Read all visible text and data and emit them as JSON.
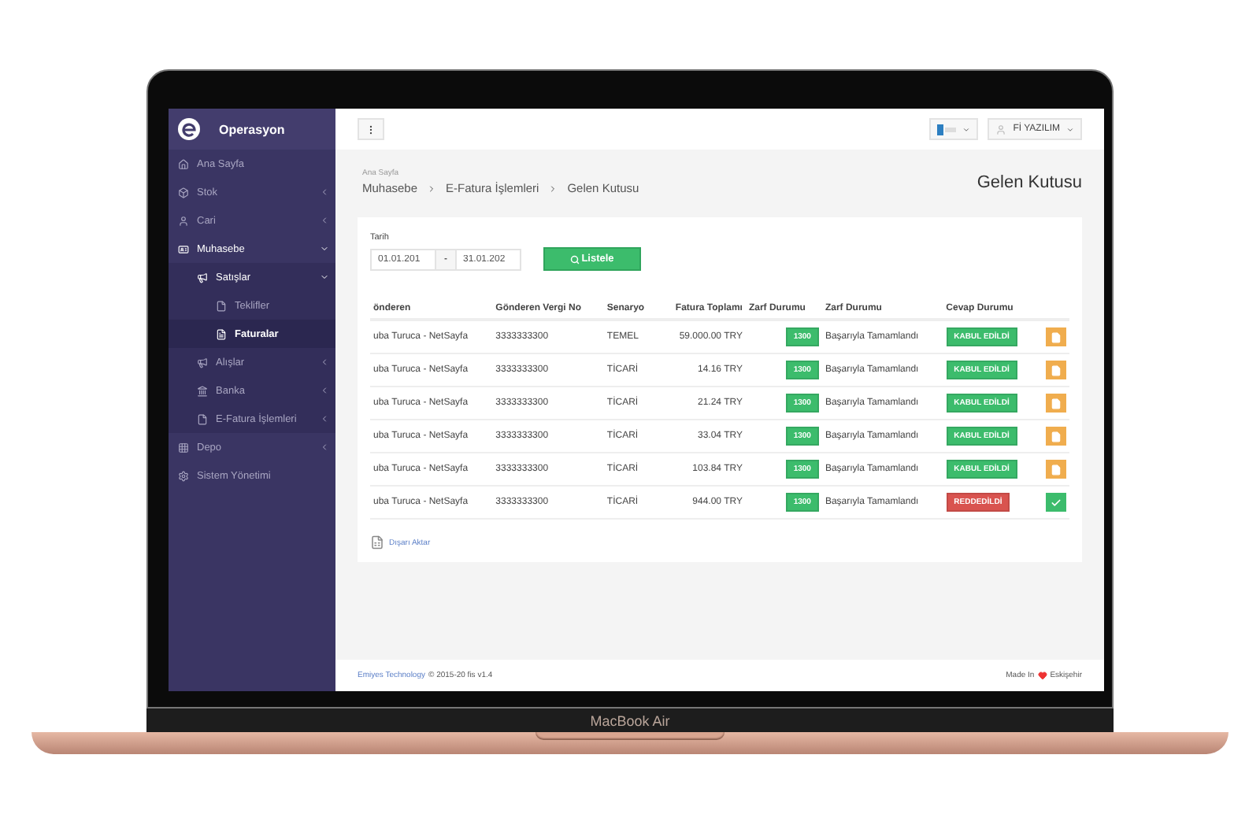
{
  "device": {
    "label": "MacBook Air"
  },
  "sidebar": {
    "title": "Operasyon",
    "items": [
      {
        "label": "Ana Sayfa",
        "expanded": false,
        "selected": false,
        "has_children": false
      },
      {
        "label": "Stok",
        "expanded": false,
        "selected": false,
        "has_children": true
      },
      {
        "label": "Cari",
        "expanded": false,
        "selected": false,
        "has_children": true
      },
      {
        "label": "Muhasebe",
        "expanded": true,
        "selected": false,
        "has_children": true,
        "children": [
          {
            "label": "Satışlar",
            "expanded": true,
            "selected": false,
            "has_children": true,
            "children": [
              {
                "label": "Teklifler",
                "expanded": false,
                "selected": false,
                "has_children": false
              },
              {
                "label": "Faturalar",
                "expanded": false,
                "selected": true,
                "has_children": false
              }
            ]
          },
          {
            "label": "Alışlar",
            "expanded": false,
            "selected": false,
            "has_children": true
          },
          {
            "label": "Banka",
            "expanded": false,
            "selected": false,
            "has_children": true
          },
          {
            "label": "E-Fatura İşlemleri",
            "expanded": false,
            "selected": false,
            "has_children": true
          }
        ]
      },
      {
        "label": "Depo",
        "expanded": false,
        "selected": false,
        "has_children": true
      },
      {
        "label": "Sistem Yönetimi",
        "expanded": false,
        "selected": false,
        "has_children": false
      }
    ]
  },
  "topbar": {
    "user": "Fİ YAZILIM"
  },
  "breadcrumb": {
    "home": "Ana Sayfa",
    "path": [
      "Muhasebe",
      "E-Fatura İşlemleri",
      "Gelen Kutusu"
    ]
  },
  "page_title": "Gelen Kutusu",
  "filter": {
    "label": "Tarih",
    "from": "01.01.201",
    "separator": "-",
    "to": "31.01.202",
    "button": "Listele"
  },
  "table": {
    "columns": [
      "önderen",
      "Gönderen Vergi No",
      "Senaryo",
      "Fatura Toplamı",
      "Zarf Durumu",
      "Zarf Durumu",
      "Cevap Durumu"
    ],
    "rows": [
      {
        "sender": "uba Turuca - NetSayfa",
        "tax_no": "3333333300",
        "scenario": "TEMEL",
        "total": "59.000.00 TRY",
        "envelope_code": "1300",
        "envelope_status": "Başarıyla Tamamlandı",
        "response": {
          "kind": "accepted",
          "label": "KABUL EDİLDİ"
        },
        "action": {
          "kind": "document"
        }
      },
      {
        "sender": "uba Turuca - NetSayfa",
        "tax_no": "3333333300",
        "scenario": "TİCARİ",
        "total": "14.16 TRY",
        "envelope_code": "1300",
        "envelope_status": "Başarıyla Tamamlandı",
        "response": {
          "kind": "accepted",
          "label": "KABUL EDİLDİ"
        },
        "action": {
          "kind": "document"
        }
      },
      {
        "sender": "uba Turuca - NetSayfa",
        "tax_no": "3333333300",
        "scenario": "TİCARİ",
        "total": "21.24 TRY",
        "envelope_code": "1300",
        "envelope_status": "Başarıyla Tamamlandı",
        "response": {
          "kind": "accepted",
          "label": "KABUL EDİLDİ"
        },
        "action": {
          "kind": "document"
        }
      },
      {
        "sender": "uba Turuca - NetSayfa",
        "tax_no": "3333333300",
        "scenario": "TİCARİ",
        "total": "33.04 TRY",
        "envelope_code": "1300",
        "envelope_status": "Başarıyla Tamamlandı",
        "response": {
          "kind": "accepted",
          "label": "KABUL EDİLDİ"
        },
        "action": {
          "kind": "document"
        }
      },
      {
        "sender": "uba Turuca - NetSayfa",
        "tax_no": "3333333300",
        "scenario": "TİCARİ",
        "total": "103.84 TRY",
        "envelope_code": "1300",
        "envelope_status": "Başarıyla Tamamlandı",
        "response": {
          "kind": "accepted",
          "label": "KABUL EDİLDİ"
        },
        "action": {
          "kind": "document"
        }
      },
      {
        "sender": "uba Turuca - NetSayfa",
        "tax_no": "3333333300",
        "scenario": "TİCARİ",
        "total": "944.00 TRY",
        "envelope_code": "1300",
        "envelope_status": "Başarıyla Tamamlandı",
        "response": {
          "kind": "rejected",
          "label": "REDDEDİLDİ"
        },
        "action": {
          "kind": "confirm"
        }
      }
    ]
  },
  "export_link": "Dışarı Aktar",
  "footer": {
    "company": "Emiyes Technology",
    "copyright": "© 2015-20 fis v1.4",
    "made_in": "Made In",
    "city": "Eskişehir"
  }
}
